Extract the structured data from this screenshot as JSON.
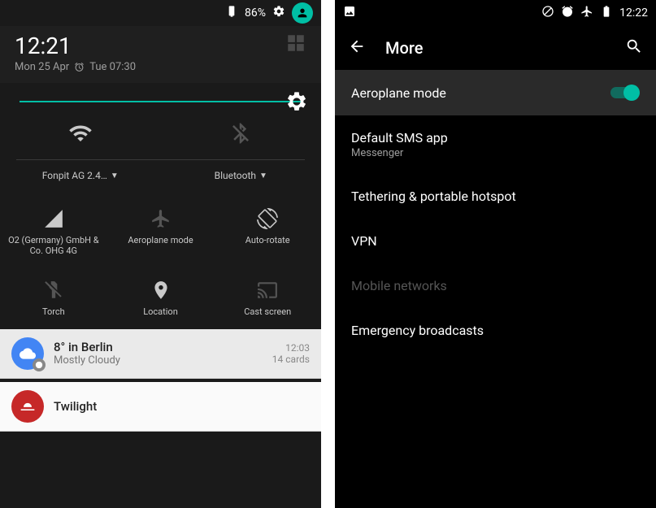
{
  "left": {
    "status": {
      "battery_pct": "86%",
      "clock": "12:21"
    },
    "header": {
      "clock": "12:21",
      "date": "Mon 25 Apr",
      "alarm": "Tue 07:30"
    },
    "tiles": {
      "wifi_label": "Fonpit AG 2.4…",
      "bluetooth_label": "Bluetooth",
      "cell_label": "O2 (Germany) GmbH & Co. OHG 4G",
      "airplane_label": "Aeroplane mode",
      "rotate_label": "Auto-rotate",
      "torch_label": "Torch",
      "location_label": "Location",
      "cast_label": "Cast screen"
    },
    "notifications": [
      {
        "title": "8° in Berlin",
        "sub": "Mostly Cloudy",
        "time": "12:03",
        "meta": "14 cards",
        "icon": "cloud",
        "color": "#4285f4"
      },
      {
        "title": "Twilight",
        "sub": "",
        "time": "",
        "meta": "",
        "icon": "twilight",
        "color": "#c62828"
      }
    ]
  },
  "right": {
    "status": {
      "clock": "12:22"
    },
    "toolbar": {
      "title": "More"
    },
    "rows": {
      "airplane": "Aeroplane mode",
      "sms_title": "Default SMS app",
      "sms_sub": "Messenger",
      "tether": "Tethering & portable hotspot",
      "vpn": "VPN",
      "mobile": "Mobile networks",
      "emergency": "Emergency broadcasts"
    }
  }
}
